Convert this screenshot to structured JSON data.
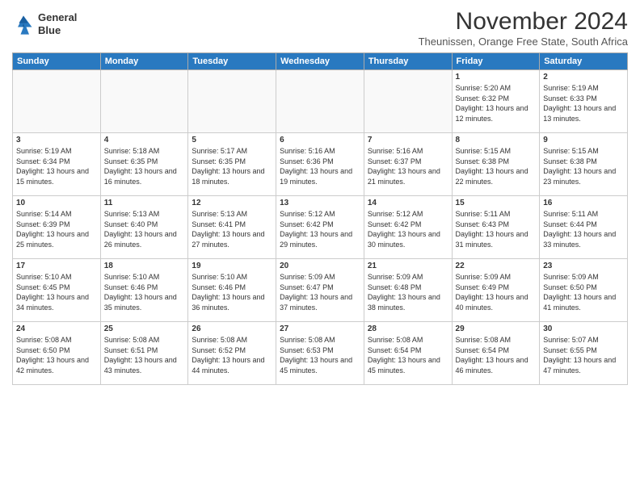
{
  "logo": {
    "line1": "General",
    "line2": "Blue"
  },
  "title": "November 2024",
  "subtitle": "Theunissen, Orange Free State, South Africa",
  "weekdays": [
    "Sunday",
    "Monday",
    "Tuesday",
    "Wednesday",
    "Thursday",
    "Friday",
    "Saturday"
  ],
  "weeks": [
    [
      {
        "day": "",
        "info": ""
      },
      {
        "day": "",
        "info": ""
      },
      {
        "day": "",
        "info": ""
      },
      {
        "day": "",
        "info": ""
      },
      {
        "day": "",
        "info": ""
      },
      {
        "day": "1",
        "info": "Sunrise: 5:20 AM\nSunset: 6:32 PM\nDaylight: 13 hours and 12 minutes."
      },
      {
        "day": "2",
        "info": "Sunrise: 5:19 AM\nSunset: 6:33 PM\nDaylight: 13 hours and 13 minutes."
      }
    ],
    [
      {
        "day": "3",
        "info": "Sunrise: 5:19 AM\nSunset: 6:34 PM\nDaylight: 13 hours and 15 minutes."
      },
      {
        "day": "4",
        "info": "Sunrise: 5:18 AM\nSunset: 6:35 PM\nDaylight: 13 hours and 16 minutes."
      },
      {
        "day": "5",
        "info": "Sunrise: 5:17 AM\nSunset: 6:35 PM\nDaylight: 13 hours and 18 minutes."
      },
      {
        "day": "6",
        "info": "Sunrise: 5:16 AM\nSunset: 6:36 PM\nDaylight: 13 hours and 19 minutes."
      },
      {
        "day": "7",
        "info": "Sunrise: 5:16 AM\nSunset: 6:37 PM\nDaylight: 13 hours and 21 minutes."
      },
      {
        "day": "8",
        "info": "Sunrise: 5:15 AM\nSunset: 6:38 PM\nDaylight: 13 hours and 22 minutes."
      },
      {
        "day": "9",
        "info": "Sunrise: 5:15 AM\nSunset: 6:38 PM\nDaylight: 13 hours and 23 minutes."
      }
    ],
    [
      {
        "day": "10",
        "info": "Sunrise: 5:14 AM\nSunset: 6:39 PM\nDaylight: 13 hours and 25 minutes."
      },
      {
        "day": "11",
        "info": "Sunrise: 5:13 AM\nSunset: 6:40 PM\nDaylight: 13 hours and 26 minutes."
      },
      {
        "day": "12",
        "info": "Sunrise: 5:13 AM\nSunset: 6:41 PM\nDaylight: 13 hours and 27 minutes."
      },
      {
        "day": "13",
        "info": "Sunrise: 5:12 AM\nSunset: 6:42 PM\nDaylight: 13 hours and 29 minutes."
      },
      {
        "day": "14",
        "info": "Sunrise: 5:12 AM\nSunset: 6:42 PM\nDaylight: 13 hours and 30 minutes."
      },
      {
        "day": "15",
        "info": "Sunrise: 5:11 AM\nSunset: 6:43 PM\nDaylight: 13 hours and 31 minutes."
      },
      {
        "day": "16",
        "info": "Sunrise: 5:11 AM\nSunset: 6:44 PM\nDaylight: 13 hours and 33 minutes."
      }
    ],
    [
      {
        "day": "17",
        "info": "Sunrise: 5:10 AM\nSunset: 6:45 PM\nDaylight: 13 hours and 34 minutes."
      },
      {
        "day": "18",
        "info": "Sunrise: 5:10 AM\nSunset: 6:46 PM\nDaylight: 13 hours and 35 minutes."
      },
      {
        "day": "19",
        "info": "Sunrise: 5:10 AM\nSunset: 6:46 PM\nDaylight: 13 hours and 36 minutes."
      },
      {
        "day": "20",
        "info": "Sunrise: 5:09 AM\nSunset: 6:47 PM\nDaylight: 13 hours and 37 minutes."
      },
      {
        "day": "21",
        "info": "Sunrise: 5:09 AM\nSunset: 6:48 PM\nDaylight: 13 hours and 38 minutes."
      },
      {
        "day": "22",
        "info": "Sunrise: 5:09 AM\nSunset: 6:49 PM\nDaylight: 13 hours and 40 minutes."
      },
      {
        "day": "23",
        "info": "Sunrise: 5:09 AM\nSunset: 6:50 PM\nDaylight: 13 hours and 41 minutes."
      }
    ],
    [
      {
        "day": "24",
        "info": "Sunrise: 5:08 AM\nSunset: 6:50 PM\nDaylight: 13 hours and 42 minutes."
      },
      {
        "day": "25",
        "info": "Sunrise: 5:08 AM\nSunset: 6:51 PM\nDaylight: 13 hours and 43 minutes."
      },
      {
        "day": "26",
        "info": "Sunrise: 5:08 AM\nSunset: 6:52 PM\nDaylight: 13 hours and 44 minutes."
      },
      {
        "day": "27",
        "info": "Sunrise: 5:08 AM\nSunset: 6:53 PM\nDaylight: 13 hours and 45 minutes."
      },
      {
        "day": "28",
        "info": "Sunrise: 5:08 AM\nSunset: 6:54 PM\nDaylight: 13 hours and 45 minutes."
      },
      {
        "day": "29",
        "info": "Sunrise: 5:08 AM\nSunset: 6:54 PM\nDaylight: 13 hours and 46 minutes."
      },
      {
        "day": "30",
        "info": "Sunrise: 5:07 AM\nSunset: 6:55 PM\nDaylight: 13 hours and 47 minutes."
      }
    ]
  ]
}
